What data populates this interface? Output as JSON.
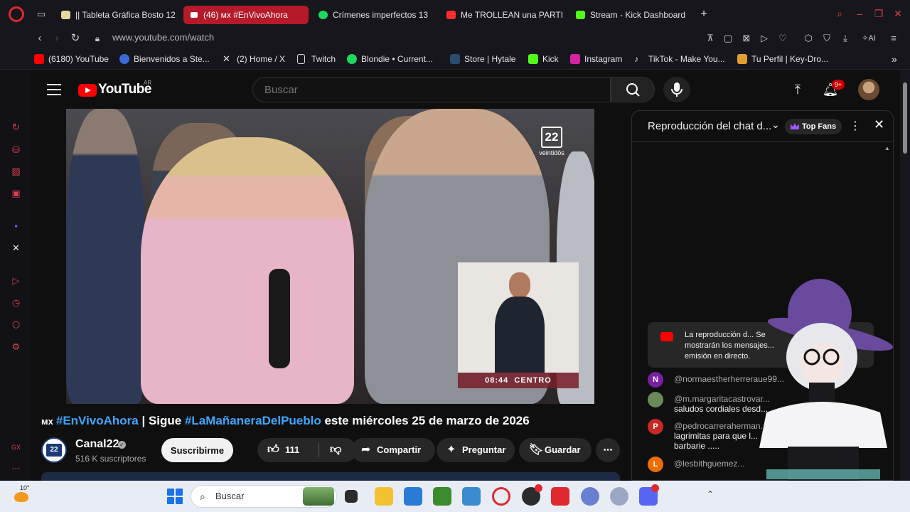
{
  "browser": {
    "tabs": [
      {
        "label": "|| Tableta Gráfica Bosto 12",
        "color": "#e8d7a0"
      },
      {
        "label": "(46) ᴍx #EnVivoAhora",
        "color": "#ff2d2d",
        "active": true
      },
      {
        "label": "Crímenes imperfectos 13",
        "color": "#1ed760"
      },
      {
        "label": "Me TROLLEAN una PARTI",
        "color": "#ff2d2d"
      },
      {
        "label": "Stream - Kick Dashboard",
        "color": "#53fc18"
      }
    ],
    "new_tab": "+",
    "url": "www.youtube.com/watch",
    "ai_label": "AI",
    "bookmarks": [
      {
        "label": "(6180) YouTube",
        "color": "#ff0000"
      },
      {
        "label": "Bienvenidos a Ste...",
        "color": "#3a6ad8"
      },
      {
        "label": "(2) Home / X",
        "color": "#222222"
      },
      {
        "label": "Twitch",
        "color": "#dddddd"
      },
      {
        "label": "Blondie • Current...",
        "color": "#1ed760"
      },
      {
        "label": "Store | Hytale",
        "color": "#2c4b6e"
      },
      {
        "label": "Kick",
        "color": "#53fc18"
      },
      {
        "label": "Instagram",
        "color": "#d6249f"
      },
      {
        "label": "TikTok - Make You...",
        "color": "#111111"
      },
      {
        "label": "Tu Perfil | Key-Dro...",
        "color": "#e0a030"
      }
    ]
  },
  "youtube": {
    "logo_text": "YouTube",
    "country": "AR",
    "search_placeholder": "Buscar",
    "notifications": "9+",
    "video": {
      "watermark_number": "22",
      "watermark_label": "veintidós",
      "clock": "08:44",
      "clock_label": "CENTRO"
    },
    "title": {
      "mx": "ᴍx",
      "tag1": "#EnVivoAhora",
      "mid": " | Sigue ",
      "tag2": "#LaMañaneraDelPueblo",
      "rest": " este miércoles 25 de marzo de 2026"
    },
    "channel": {
      "name": "Canal22",
      "subscribers": "516 K suscriptores"
    },
    "subscribe_label": "Suscribirme",
    "likes": "111",
    "share_label": "Compartir",
    "ask_label": "Preguntar",
    "save_label": "Guardar",
    "chat": {
      "title": "Reproducción del chat d...",
      "top_fans": "Top Fans",
      "replay_note": "La reproducción d... Se mostrarán los mensajes... emisión en directo.",
      "messages": [
        {
          "initial": "N",
          "color": "#7b1fa2",
          "author": "@normaestherherreraue99...",
          "body": ""
        },
        {
          "initial": "",
          "color": "#6a8a5a",
          "author": "@m.margaritacastrovar...",
          "body": "saludos cordiales desd..."
        },
        {
          "initial": "P",
          "color": "#c62828",
          "author": "@pedrocarreraherman...",
          "body": "lagrimitas para que l... barbarie ....."
        },
        {
          "initial": "L",
          "color": "#ef6c00",
          "author": "@lesbithguemez...",
          "body": ""
        }
      ]
    }
  },
  "taskbar": {
    "weather_temp": "10°",
    "search_placeholder": "Buscar"
  }
}
